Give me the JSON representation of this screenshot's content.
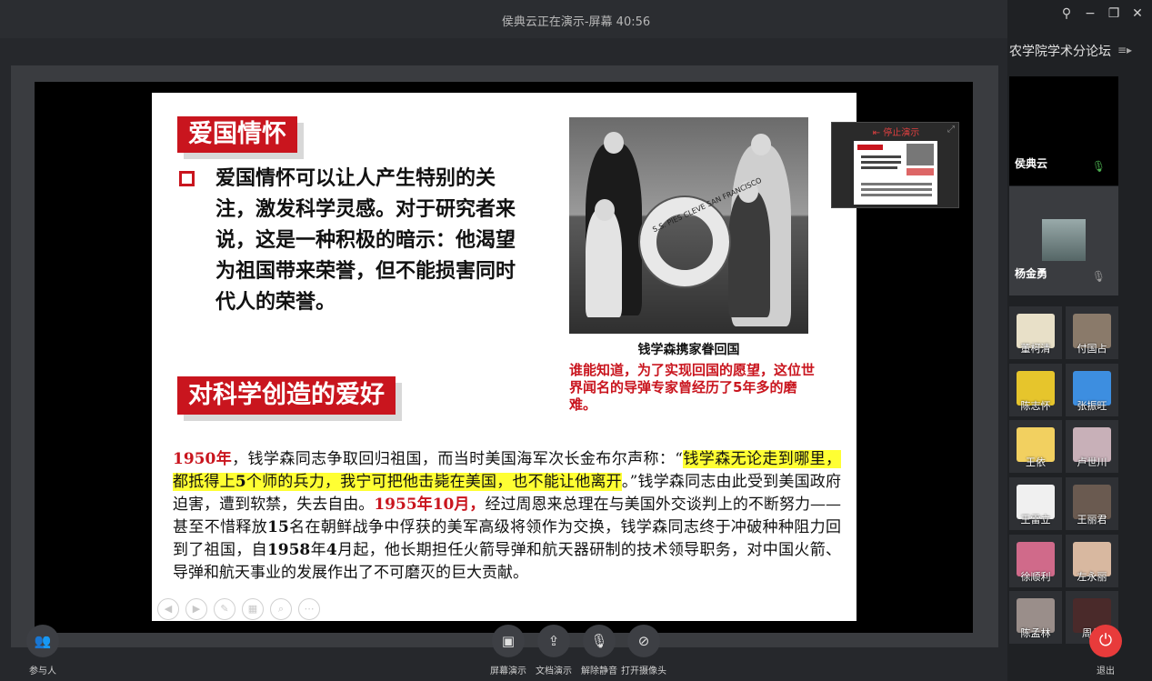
{
  "window": {
    "title": "侯典云正在演示-屏幕 40:56",
    "controls": [
      "pin-icon",
      "minimize-icon",
      "restore-icon",
      "close-icon"
    ]
  },
  "slide": {
    "heading1": "爱国情怀",
    "patriot_text": "爱国情怀可以让人产生特别的关注，激发科学灵感。对于研究者来说，这是一种积极的暗示：他渴望为祖国带来荣誉，但不能损害同时代人的荣誉。",
    "heading2": "对科学创造的爱好",
    "photo_caption": "钱学森携家眷回国",
    "photo_ring_text": "S.S. PIES CLEVE SAN FRANCISCO",
    "red_note": "谁能知道，为了实现回国的愿望，这位世界闻名的导弹专家曾经历了5年多的磨难。",
    "para": {
      "p1_year": "1950年",
      "p2": "，钱学森同志争取回归祖国，而当时美国海军次长金布尔声称：“",
      "p3_highlight_a": "钱学森无论走到哪里，都抵得上",
      "p3_highlight_b": "5",
      "p3_highlight_c": "个师的兵力，我宁可把他击毙在美国，也不能让他离开",
      "p4": "。”钱学森同志由此受到美国政府迫害，遭到软禁，失去自由。",
      "p5_date": "1955年10月，",
      "p6": "经过周恩来总理在与美国外交谈判上的不断努力——甚至不惜释放",
      "p7_num": "15",
      "p8": "名在朝鲜战争中俘获的美军高级将领作为交换，钱学森同志终于冲破种种阻力回到了祖国，自",
      "p9_year": "1958",
      "p10": "年",
      "p11_month": "4",
      "p12": "月起，他长期担任火箭导弹和航天器研制的技术领导职务，对中国火箭、导弹和航天事业的发展作出了不可磨灭的巨大贡献。"
    },
    "tools": [
      "prev-icon",
      "next-icon",
      "pen-icon",
      "thumbnails-icon",
      "zoom-icon",
      "more-icon"
    ]
  },
  "preview": {
    "stop_label": "停止演示"
  },
  "bottombar": {
    "participants_label": "参与人",
    "screen_share_label": "屏幕演示",
    "doc_share_label": "文档演示",
    "unmute_label": "解除静音",
    "camera_label": "打开摄像头",
    "exit_label": "退出"
  },
  "sidebar": {
    "title": "农学院学术分论坛",
    "presenters": [
      {
        "name": "侯典云",
        "mic": "on"
      },
      {
        "name": "杨金勇",
        "mic": "muted"
      }
    ],
    "participants": [
      "董柯清",
      "付国占",
      "陈志怀",
      "张振旺",
      "王依",
      "卢世川",
      "王雷立",
      "王丽君",
      "徐顺利",
      "左永丽",
      "陈孟林",
      "周佳"
    ]
  },
  "colors": {
    "accent_red": "#c9151e",
    "highlight_yellow": "#ffff33",
    "exit_red": "#e83b3b"
  }
}
